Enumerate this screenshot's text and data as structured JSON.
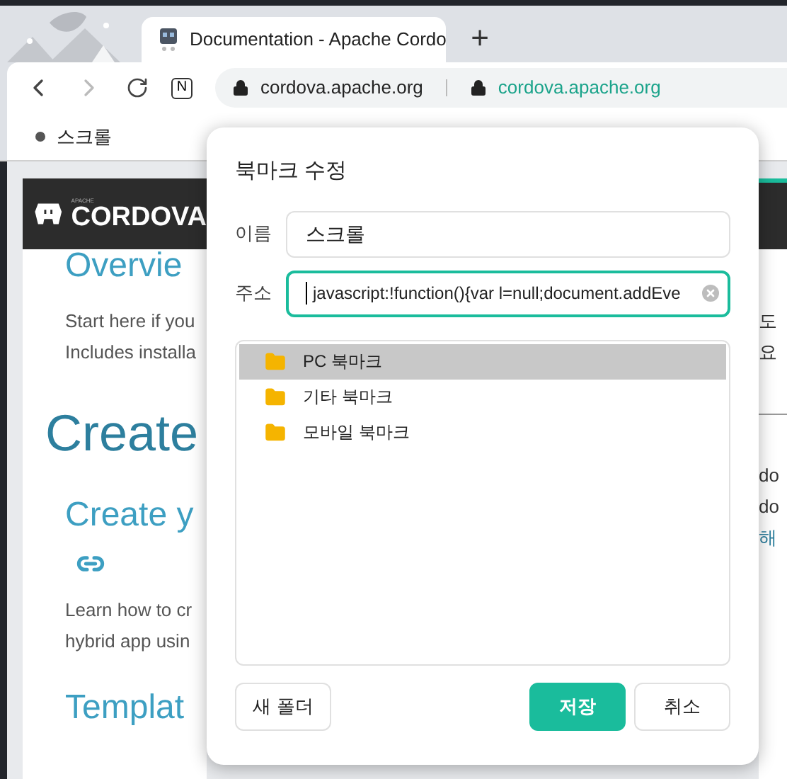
{
  "browser": {
    "tab": {
      "title": "Documentation - Apache Cordo",
      "selected": true
    },
    "new_tab": "+",
    "extension_label": "N",
    "address": {
      "host": "cordova.apache.org",
      "site": "cordova.apache.org"
    },
    "bookmarks": [
      {
        "label": "스크롤"
      }
    ]
  },
  "page": {
    "logo_small": "APACHE",
    "logo": "CORDOVA",
    "left": [
      {
        "kind": "h3",
        "text": "Overvie"
      },
      {
        "kind": "p",
        "text": "Start here if you"
      },
      {
        "kind": "p",
        "text": "Includes installa"
      },
      {
        "kind": "h1",
        "text": "Create"
      },
      {
        "kind": "h3",
        "text": "Create y"
      },
      {
        "kind": "link"
      },
      {
        "kind": "p",
        "text": "Learn how to cr"
      },
      {
        "kind": "p",
        "text": "hybrid app usin"
      },
      {
        "kind": "h3",
        "text": "Templat"
      }
    ],
    "right": [
      {
        "kind": "p",
        "text": "도"
      },
      {
        "kind": "p",
        "text": "요"
      },
      {
        "kind": "link"
      },
      {
        "kind": "p",
        "text": "do"
      },
      {
        "kind": "p",
        "text": "do"
      },
      {
        "kind": "a",
        "text": "해"
      }
    ]
  },
  "dialog": {
    "title": "북마크 수정",
    "fields": [
      {
        "label": "이름",
        "value": "스크롤",
        "focused": false
      },
      {
        "label": "주소",
        "value": "javascript:!function(){var l=null;document.addEve",
        "focused": true
      }
    ],
    "folders": [
      {
        "label": "PC 북마크",
        "selected": true
      },
      {
        "label": "기타 북마크",
        "selected": false
      },
      {
        "label": "모바일 북마크",
        "selected": false
      }
    ],
    "buttons": [
      {
        "label": "새 폴더",
        "kind": "secondary"
      },
      {
        "label": "저장",
        "kind": "primary"
      },
      {
        "label": "취소",
        "kind": "secondary"
      }
    ]
  }
}
